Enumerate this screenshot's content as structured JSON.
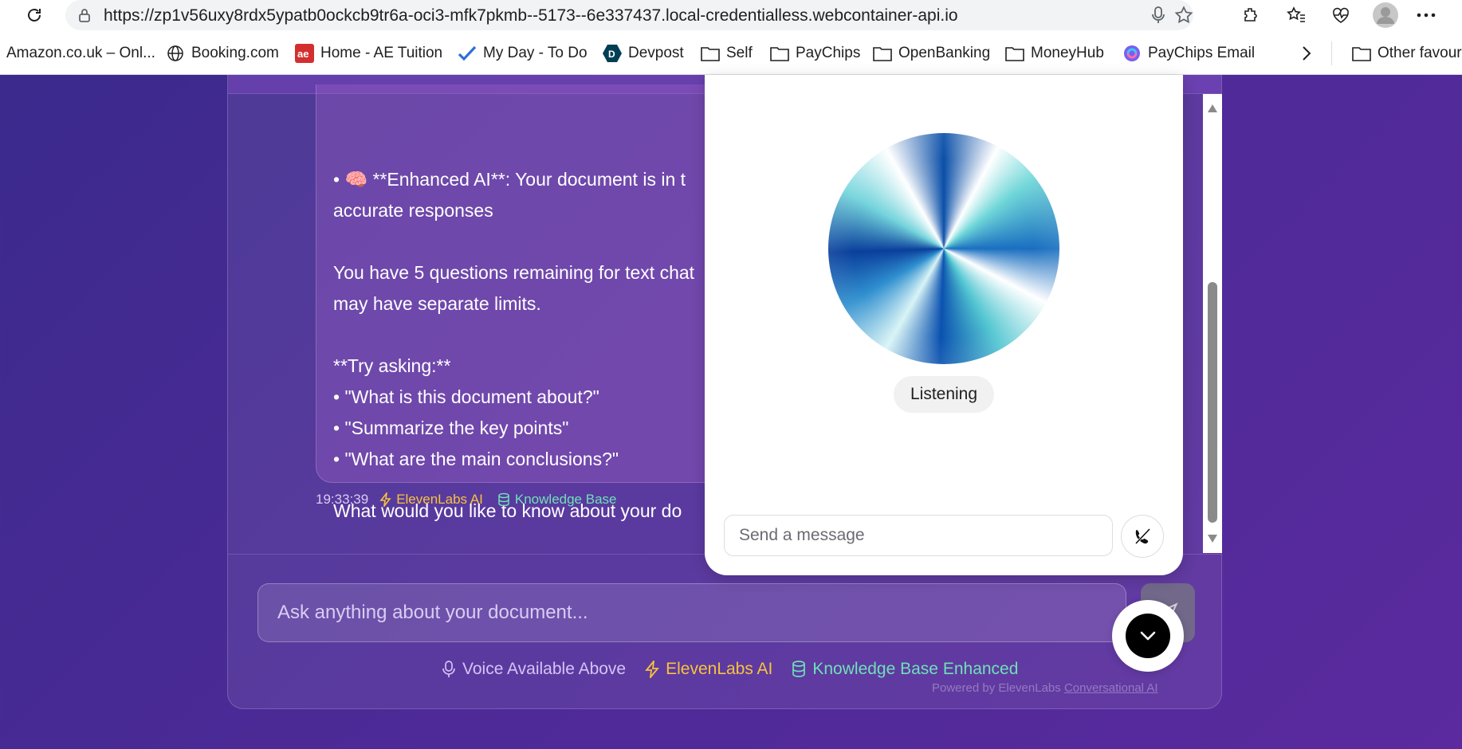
{
  "browser": {
    "url": "https://zp1v56uxy8rdx5ypatb0ockcb9tr6a-oci3-mfk7pkmb--5173--6e337437.local-credentialless.webcontainer-api.io",
    "bookmarks": [
      {
        "label": "Amazon.co.uk – Onl...",
        "icon": "amazon-icon"
      },
      {
        "label": "Booking.com",
        "icon": "globe-icon"
      },
      {
        "label": "Home - AE Tuition",
        "icon": "ae-logo-icon"
      },
      {
        "label": "My Day - To Do",
        "icon": "checkmark-icon"
      },
      {
        "label": "Devpost",
        "icon": "devpost-icon"
      },
      {
        "label": "Self",
        "icon": "folder-icon"
      },
      {
        "label": "PayChips",
        "icon": "folder-icon"
      },
      {
        "label": "OpenBanking",
        "icon": "folder-icon"
      },
      {
        "label": "MoneyHub",
        "icon": "folder-icon"
      },
      {
        "label": "PayChips Email",
        "icon": "copilot-icon"
      },
      {
        "label": "Other favourites",
        "icon": "folder-icon"
      }
    ]
  },
  "chat": {
    "message_lines": [
      "• 🧠 **Enhanced AI**: Your document is in t",
      "accurate responses",
      "",
      "You have 5 questions remaining for text chat",
      "may have separate limits.",
      "",
      "**Try asking:**",
      "• \"What is this document about?\"",
      "• \"Summarize the key points\"",
      "• \"What are the main conclusions?\"",
      "",
      "What would you like to know about your do"
    ],
    "timestamp": "19:33:39",
    "source_ai": "ElevenLabs AI",
    "source_kb": "Knowledge Base",
    "input_placeholder": "Ask anything about your document...",
    "footer": {
      "voice": "Voice Available Above",
      "ai": "ElevenLabs AI",
      "kb": "Knowledge Base Enhanced"
    },
    "powered_prefix": "Powered by ElevenLabs ",
    "powered_link": "Conversational AI"
  },
  "widget": {
    "status": "Listening",
    "input_placeholder": "Send a message"
  },
  "colors": {
    "accent_ai": "#f8c23c",
    "accent_kb": "#6fe0b8",
    "background": "#4b2a96"
  }
}
